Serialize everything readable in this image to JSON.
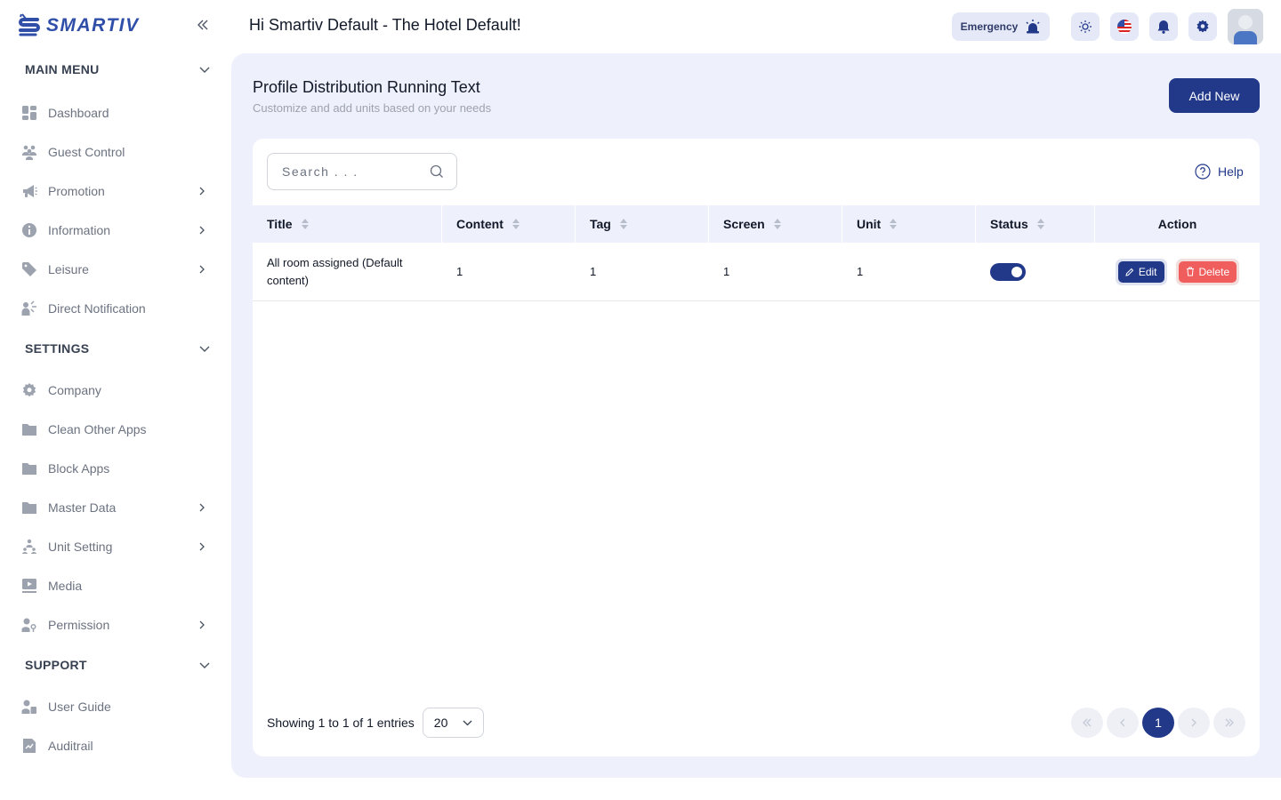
{
  "brand": {
    "name": "SMARTIV",
    "primary_color": "#22398a",
    "panel_color": "#eef0fc"
  },
  "header": {
    "greeting": "Hi Smartiv Default - The Hotel Default!",
    "emergency_label": "Emergency",
    "icons": [
      "sun-icon",
      "us-flag-icon",
      "bell-icon",
      "gear-icon",
      "avatar"
    ]
  },
  "sidebar": {
    "sections": [
      {
        "title": "MAIN MENU",
        "items": [
          {
            "label": "Dashboard",
            "icon": "dashboard-icon",
            "has_children": false
          },
          {
            "label": "Guest Control",
            "icon": "users-icon",
            "has_children": false
          },
          {
            "label": "Promotion",
            "icon": "megaphone-icon",
            "has_children": true
          },
          {
            "label": "Information",
            "icon": "info-icon",
            "has_children": true
          },
          {
            "label": "Leisure",
            "icon": "tag-icon",
            "has_children": true
          },
          {
            "label": "Direct Notification",
            "icon": "user-notify-icon",
            "has_children": false
          }
        ]
      },
      {
        "title": "SETTINGS",
        "items": [
          {
            "label": "Company",
            "icon": "gear-icon",
            "has_children": false
          },
          {
            "label": "Clean Other Apps",
            "icon": "folder-icon",
            "has_children": false
          },
          {
            "label": "Block Apps",
            "icon": "folder-icon",
            "has_children": false
          },
          {
            "label": "Master Data",
            "icon": "folder-icon",
            "has_children": true
          },
          {
            "label": "Unit Setting",
            "icon": "sitemap-icon",
            "has_children": true
          },
          {
            "label": "Media",
            "icon": "media-icon",
            "has_children": false
          },
          {
            "label": "Permission",
            "icon": "user-key-icon",
            "has_children": true
          }
        ]
      },
      {
        "title": "SUPPORT",
        "items": [
          {
            "label": "User Guide",
            "icon": "user-guide-icon",
            "has_children": false
          },
          {
            "label": "Auditrail",
            "icon": "audit-icon",
            "has_children": false
          }
        ]
      }
    ]
  },
  "page": {
    "title": "Profile Distribution Running Text",
    "subtitle": "Customize and add units based on your needs",
    "add_button": "Add New",
    "search_placeholder": "Search . . .",
    "help_label": "Help"
  },
  "table": {
    "columns": [
      "Title",
      "Content",
      "Tag",
      "Screen",
      "Unit",
      "Status",
      "Action"
    ],
    "rows": [
      {
        "title": "All room assigned (Default content)",
        "content": "1",
        "tag": "1",
        "screen": "1",
        "unit": "1",
        "status": true,
        "edit_label": "Edit",
        "delete_label": "Delete"
      }
    ]
  },
  "footer": {
    "showing": "Showing 1 to 1 of 1 entries",
    "per_page": "20",
    "current_page": "1"
  }
}
